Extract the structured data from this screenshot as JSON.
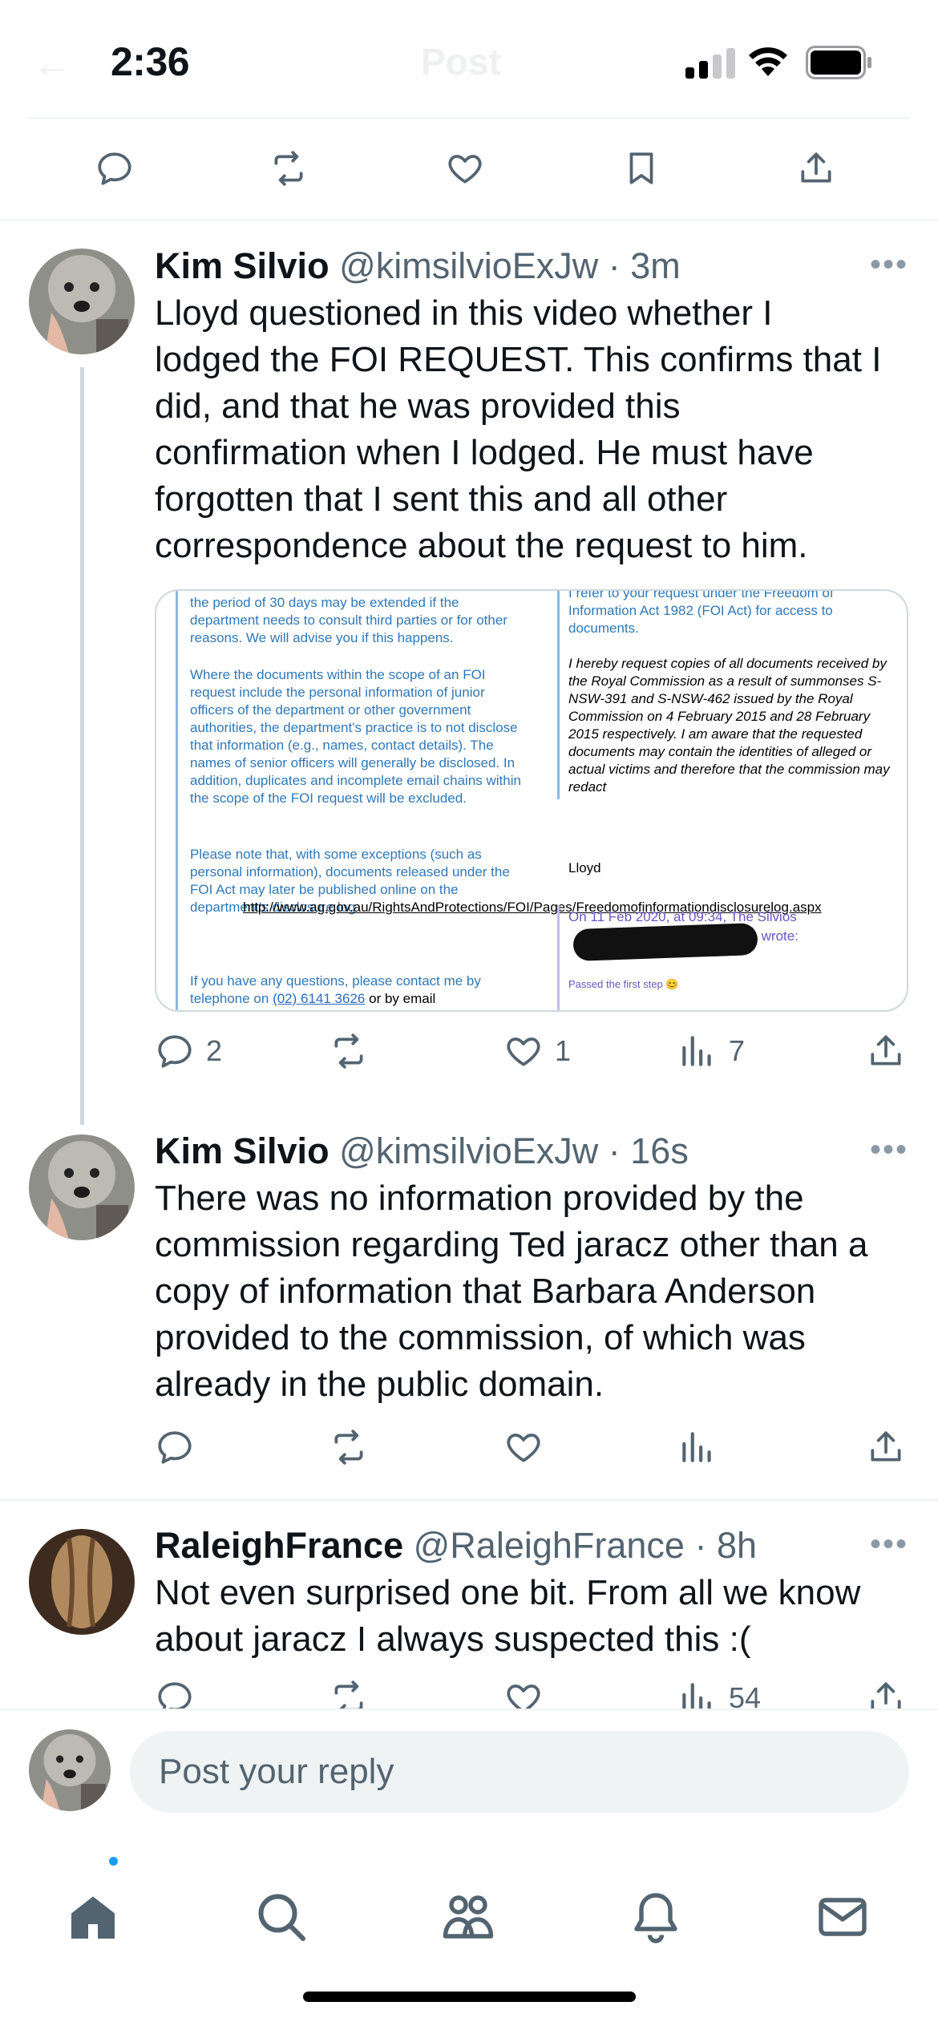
{
  "status_bar": {
    "time": "2:36",
    "header_title": "Post"
  },
  "top_actions": [
    "reply-icon",
    "repost-icon",
    "like-icon",
    "bookmark-icon",
    "share-icon"
  ],
  "tweets": [
    {
      "name": "Kim Silvio",
      "handle": "@kimsilvioExJw",
      "time": "3m",
      "text_lines": [
        "Lloyd questioned in this video whether I",
        "lodged the FOI REQUEST. This confirms that I",
        "did, and that he was provided this",
        "confirmation when I lodged. He must have",
        "forgotten that I sent this and all other",
        "correspondence about the request to him."
      ],
      "media": {
        "left_paragraphs": [
          "the period of 30 days may be extended if the department needs to consult third parties or for other reasons. We will advise you if this happens.",
          "Where the documents within the scope of an FOI request include the personal information of junior officers of the department or other government authorities, the department's practice is to not disclose that information (e.g., names, contact details). The names of senior officers will generally be disclosed. In addition, duplicates and incomplete email chains within the scope of the FOI request will be excluded.",
          "Please note that, with some exceptions (such as personal information), documents released under the FOI Act may later be published online on the department's disclosure log",
          "http://www.ag.gov.au/RightsAndProtections/FOI/Pages/Freedomofinformationdisclosurelog.aspx",
          "If you have any questions, please contact me by telephone on",
          "(02) 6141 3626",
          "or by email"
        ],
        "right_intro": "I refer to your request under the Freedom of Information Act 1982 (FOI Act) for access to documents.",
        "right_quote": "I hereby request copies of all documents received by the Royal Commission as a result of summonses S-NSW-391 and S-NSW-462 issued by the Royal Commission on 4 February 2015 and 28 February 2015 respectively. I am aware that the requested documents may contain the identities of alleged or actual victims and therefore that the commission may redact",
        "right_sign": "Lloyd",
        "right_quote_header": "On 11 Feb 2020, at 09:34, The Silvios",
        "right_wrote": "> wrote:",
        "right_passed": "Passed the first step 😊"
      },
      "stats": {
        "replies": "2",
        "reposts": "",
        "likes": "1",
        "views": "7"
      }
    },
    {
      "name": "Kim Silvio",
      "handle": "@kimsilvioExJw",
      "time": "16s",
      "text_lines": [
        "There was no information provided by the",
        "commission regarding Ted jaracz other than a",
        "copy of information that Barbara Anderson",
        "provided to the commission, of which was",
        "already in the public domain."
      ],
      "stats": {
        "replies": "",
        "reposts": "",
        "likes": "",
        "views": ""
      }
    },
    {
      "name": "RaleighFrance",
      "handle": "@RaleighFrance",
      "time": "8h",
      "text_lines": [
        "Not even surprised one bit. From all we know",
        "about jaracz I always suspected this :("
      ],
      "stats": {
        "replies": "",
        "reposts": "",
        "likes": "",
        "views": "54"
      }
    }
  ],
  "reply_bar": {
    "placeholder": "Post your reply"
  },
  "tab_bar": [
    "home-icon",
    "search-icon",
    "communities-icon",
    "notifications-icon",
    "messages-icon"
  ],
  "colors": {
    "text": "#0f1419",
    "secondary": "#536471",
    "accent": "#1d9bf0",
    "divider": "#eff3f4"
  }
}
